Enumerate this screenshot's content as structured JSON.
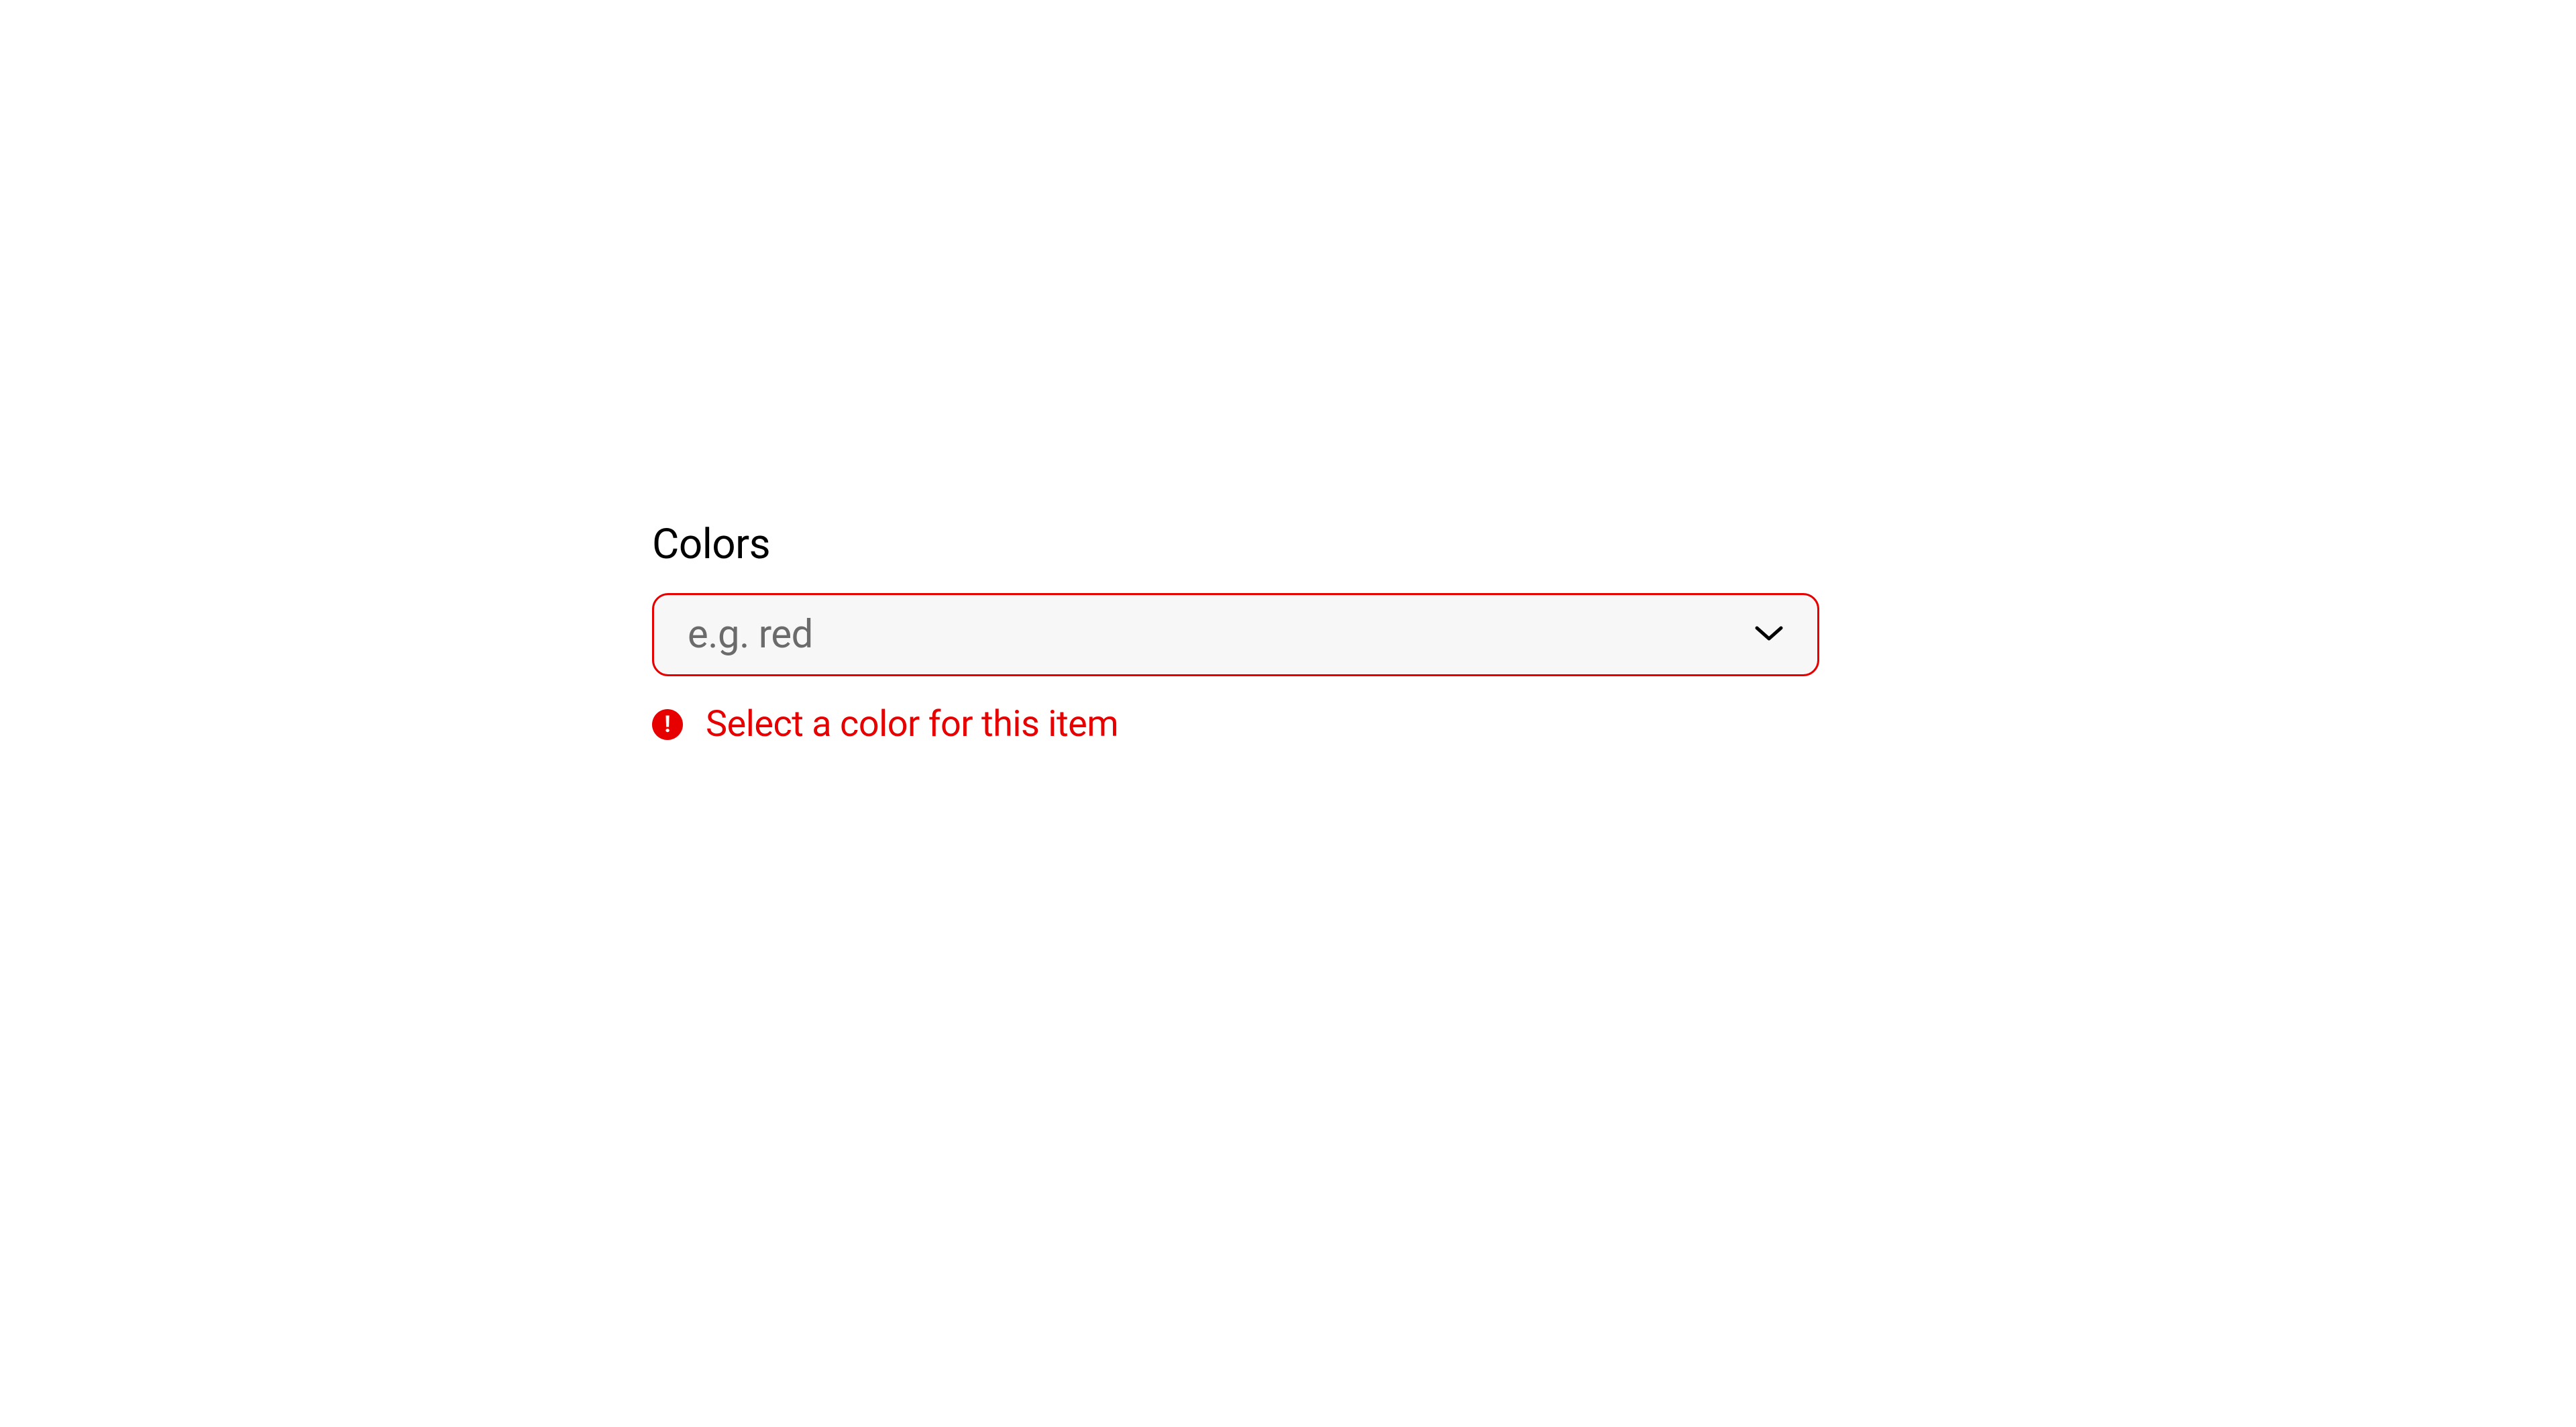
{
  "field": {
    "label": "Colors",
    "placeholder": "e.g. red",
    "error_message": "Select a color for this item"
  },
  "colors": {
    "error": "#e60000",
    "input_bg": "#f7f7f7",
    "placeholder_text": "#6b6b6b"
  }
}
